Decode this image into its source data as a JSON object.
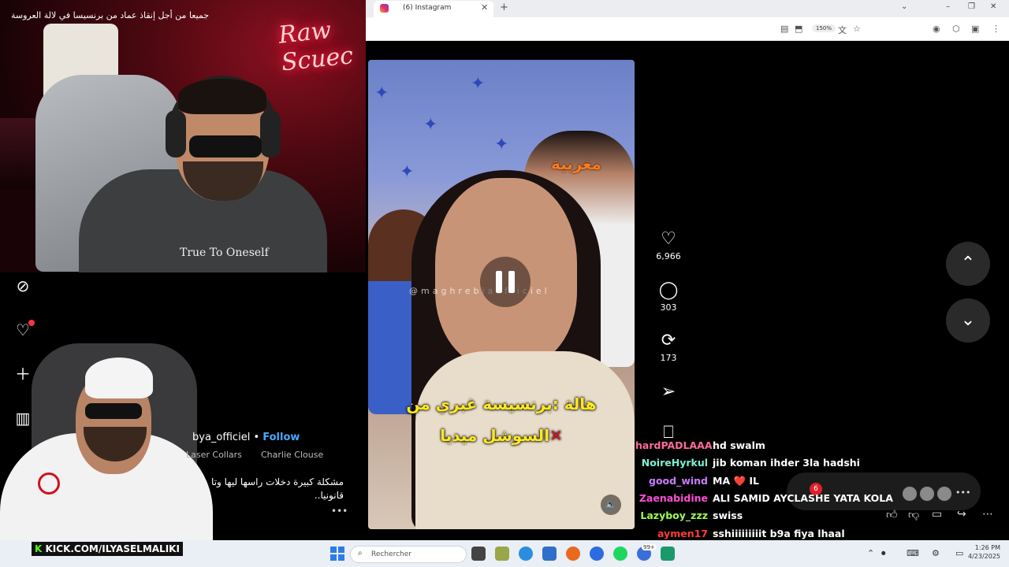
{
  "stream": {
    "title": "جميعا من أجل إنقاذ عماد من برنسيسا في لالة العروسة",
    "neon_sign": "Raw Scuec",
    "shirt_text": "True To Oneself",
    "kick_prefix": "K",
    "kick_url": "KICK.COM/ILYASELMALIKI"
  },
  "browser": {
    "tab_title": "(6) Instagram",
    "tab_close": "✕",
    "new_tab": "+",
    "zoom": "150%",
    "window_controls": [
      "⌄",
      "–",
      "❐",
      "✕"
    ]
  },
  "reel": {
    "watermark": "@maghrebiaofficiel",
    "overlay_tag": "مغربية",
    "caption_line1": "هالة :برنسيسة غبري من",
    "caption_line2": "السوشل ميديا",
    "caption_mark": "✕",
    "likes": "6,966",
    "comments": "303",
    "reposts": "173",
    "icons": {
      "like": "♡",
      "comment": "◯",
      "repost": "⟳",
      "share": "➢",
      "save": "⎕",
      "mute": "🔈"
    }
  },
  "post": {
    "username": "bya_officiel",
    "separator": "•",
    "follow": "Follow",
    "music_1": "Laser Collars",
    "music_2": "Charlie Clouse",
    "caption": "مشكلة كبيرة دخلات راسها ليها وتا قانونيا..",
    "more": "•••"
  },
  "sidebar": {
    "icons": [
      "compass-icon",
      "heart-icon",
      "plus-icon",
      "dashboard-icon",
      "menu-icon"
    ]
  },
  "navigation": {
    "up": "⌃",
    "down": "⌄"
  },
  "chat": [
    {
      "user": "hardPADLAAA",
      "color": "#ff6b9d",
      "message": "hd swalm"
    },
    {
      "user": "NoireHyrkul",
      "color": "#7ef0d4",
      "message": "jib koman ihder 3la hadshi"
    },
    {
      "user": "good_wind",
      "color": "#c77dff",
      "message": "MA ❤️ IL"
    },
    {
      "user": "Zaenabidine",
      "color": "#ff4fd8",
      "message": "ALI SAMID AYCLASHE YATA KOLA"
    },
    {
      "user": "Lazyboy_zzz",
      "color": "#9cff57",
      "message": "swiss"
    },
    {
      "user": "aymen17",
      "color": "#ff3b3b",
      "message": "sshiiiiiiiiit b9a fiya lhaal"
    }
  ],
  "yt_overlay": {
    "badge": "6",
    "more": "•••"
  },
  "taskbar": {
    "search_placeholder": "Rechercher",
    "badge": "99+",
    "time": "1:26 PM",
    "date": "4/23/2025"
  }
}
